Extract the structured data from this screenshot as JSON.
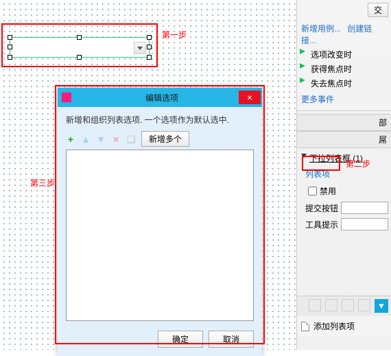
{
  "canvas": {
    "step1_label": "第一步",
    "step3_label": "第三步"
  },
  "dialog": {
    "title": "编辑选项",
    "description": "新增和组织列表选项. 一个选项作为默认选中.",
    "add_multiple_btn": "新增多个",
    "ok_btn": "确定",
    "cancel_btn": "取消"
  },
  "inspector": {
    "top_button": "交",
    "link_new_case": "新增用例...",
    "link_create_link": "创建链接...",
    "events": [
      "选项改变时",
      "获得焦点时",
      "失去焦点时"
    ],
    "more_events": "更多事件",
    "panel_head_right": "部",
    "panel_sub_right": "屌",
    "accordion_header": "下拉列表框 (1)",
    "list_items_link": "列表项",
    "step2_label": "第二步",
    "disable_label": "禁用",
    "submit_label": "提交按钮",
    "tooltip_label": "工具提示",
    "submit_value": "",
    "tooltip_value": "",
    "add_list_item": "添加列表项"
  }
}
